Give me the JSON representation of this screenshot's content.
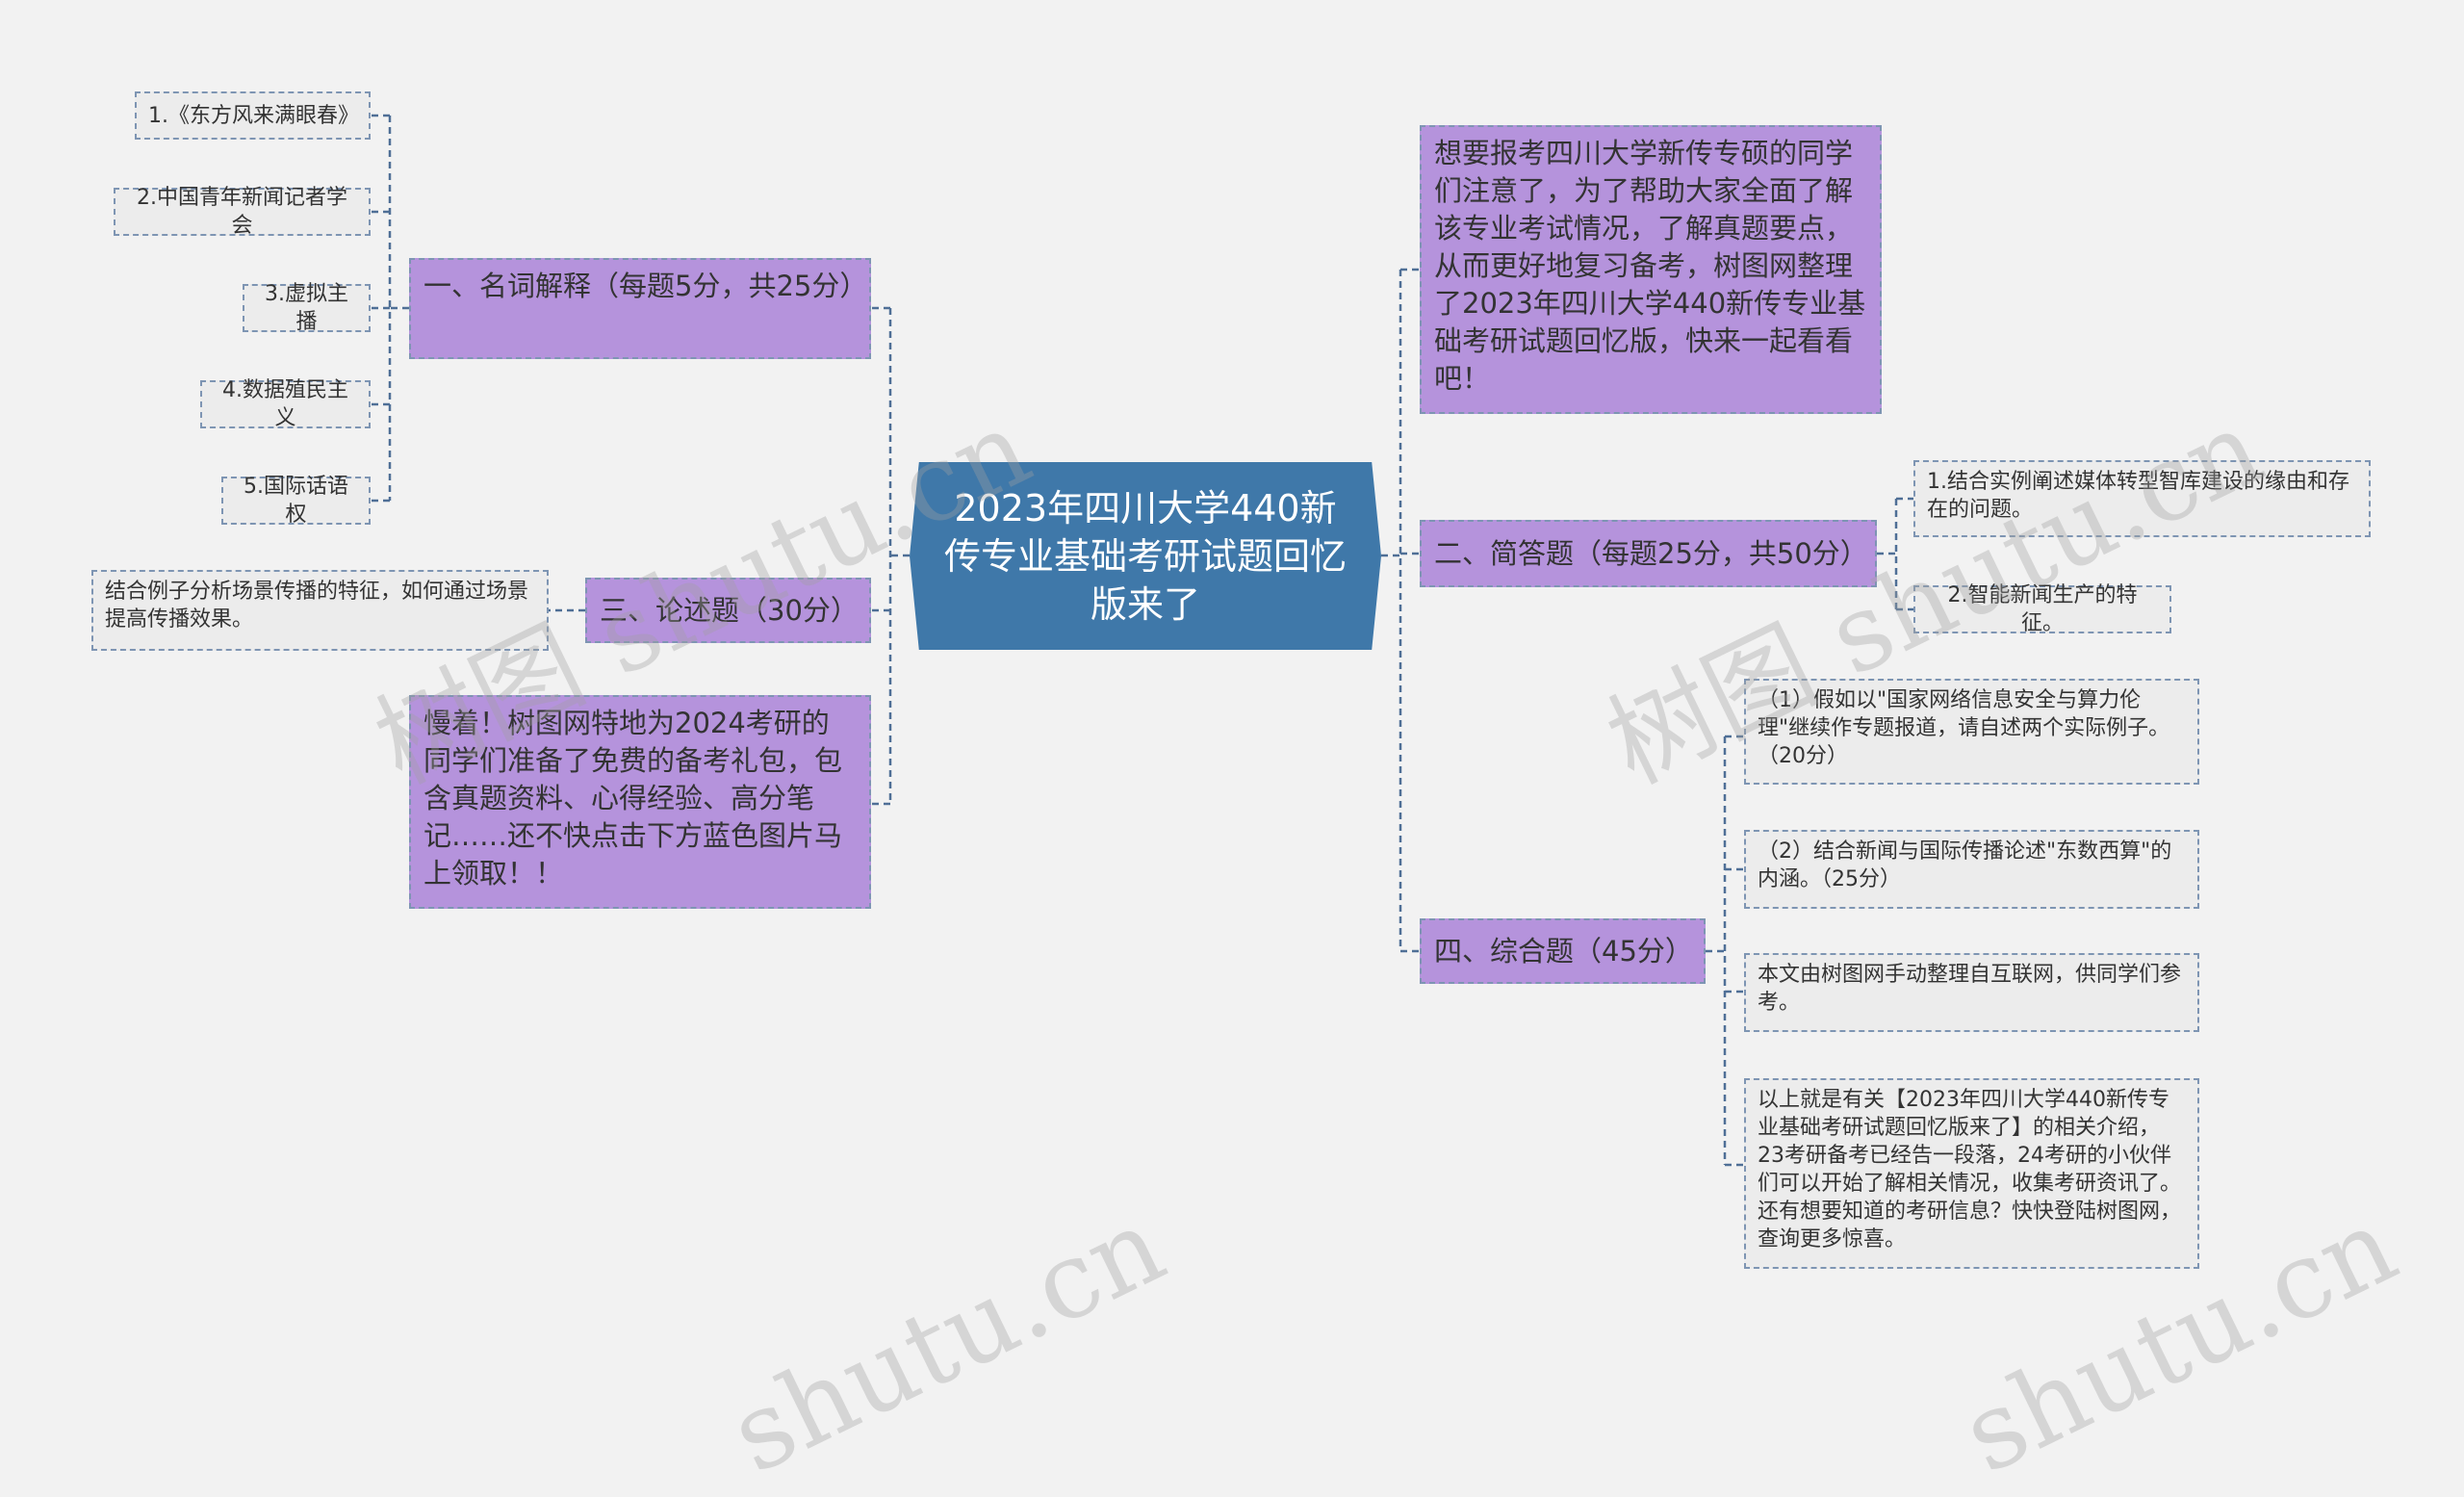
{
  "center": {
    "title": "2023年四川大学440新传专业基础考研试题回忆版来了"
  },
  "left": {
    "b1": {
      "label": "一、名词解释（每题5分，共25分）",
      "items": [
        "1.《东方风来满眼春》",
        "2.中国青年新闻记者学会",
        "3.虚拟主播",
        "4.数据殖民主义",
        "5.国际话语权"
      ]
    },
    "b3": {
      "label": "三、论述题（30分）",
      "items": [
        "结合例子分析场景传播的特征，如何通过场景提高传播效果。"
      ]
    },
    "promo": {
      "text": "慢着！树图网特地为2024考研的同学们准备了免费的备考礼包，包含真题资料、心得经验、高分笔记……还不快点击下方蓝色图片马上领取！！"
    }
  },
  "right": {
    "intro": {
      "text": "想要报考四川大学新传专硕的同学们注意了，为了帮助大家全面了解该专业考试情况，了解真题要点，从而更好地复习备考，树图网整理了2023年四川大学440新传专业基础考研试题回忆版，快来一起看看吧！"
    },
    "b2": {
      "label": "二、简答题（每题25分，共50分）",
      "items": [
        "1.结合实例阐述媒体转型智库建设的缘由和存在的问题。",
        "2.智能新闻生产的特征。"
      ]
    },
    "b4": {
      "label": "四、综合题（45分）",
      "items": [
        "（1）假如以\"国家网络信息安全与算力伦理\"继续作专题报道，请自述两个实际例子。（20分）",
        "（2）结合新闻与国际传播论述\"东数西算\"的内涵。（25分）",
        "本文由树图网手动整理自互联网，供同学们参考。",
        "以上就是有关【2023年四川大学440新传专业基础考研试题回忆版来了】的相关介绍，23考研备考已经告一段落，24考研的小伙伴们可以开始了解相关情况，收集考研资讯了。还有想要知道的考研信息？快快登陆树图网，查询更多惊喜。"
      ]
    }
  },
  "watermark": {
    "text": "树图 shutu.cn",
    "text_short": "shutu.cn"
  },
  "colors": {
    "center": "#3f78a9",
    "branch": "#b593dc",
    "leaf": "#ececec",
    "line": "#4f6f96",
    "background": "#f2f2f2"
  }
}
